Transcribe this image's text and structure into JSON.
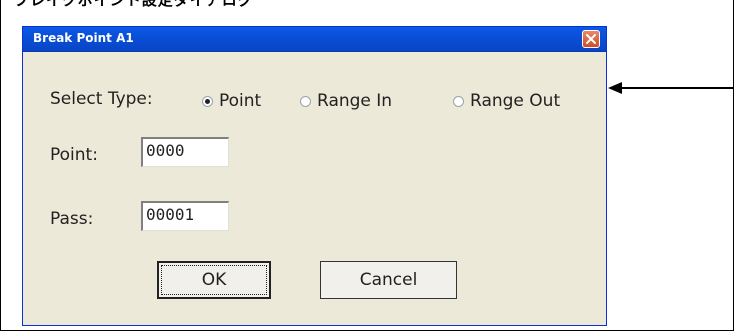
{
  "document": {
    "heading": "ブレイクポイント設定ダイアログ"
  },
  "window": {
    "title": "Break Point A1"
  },
  "select_type": {
    "label": "Select Type:",
    "options": [
      {
        "label": "Point",
        "selected": true
      },
      {
        "label": "Range In",
        "selected": false
      },
      {
        "label": "Range Out",
        "selected": false
      }
    ]
  },
  "point": {
    "label": "Point:",
    "value": "0000"
  },
  "pass": {
    "label": "Pass:",
    "value": "00001"
  },
  "buttons": {
    "ok": "OK",
    "cancel": "Cancel"
  }
}
